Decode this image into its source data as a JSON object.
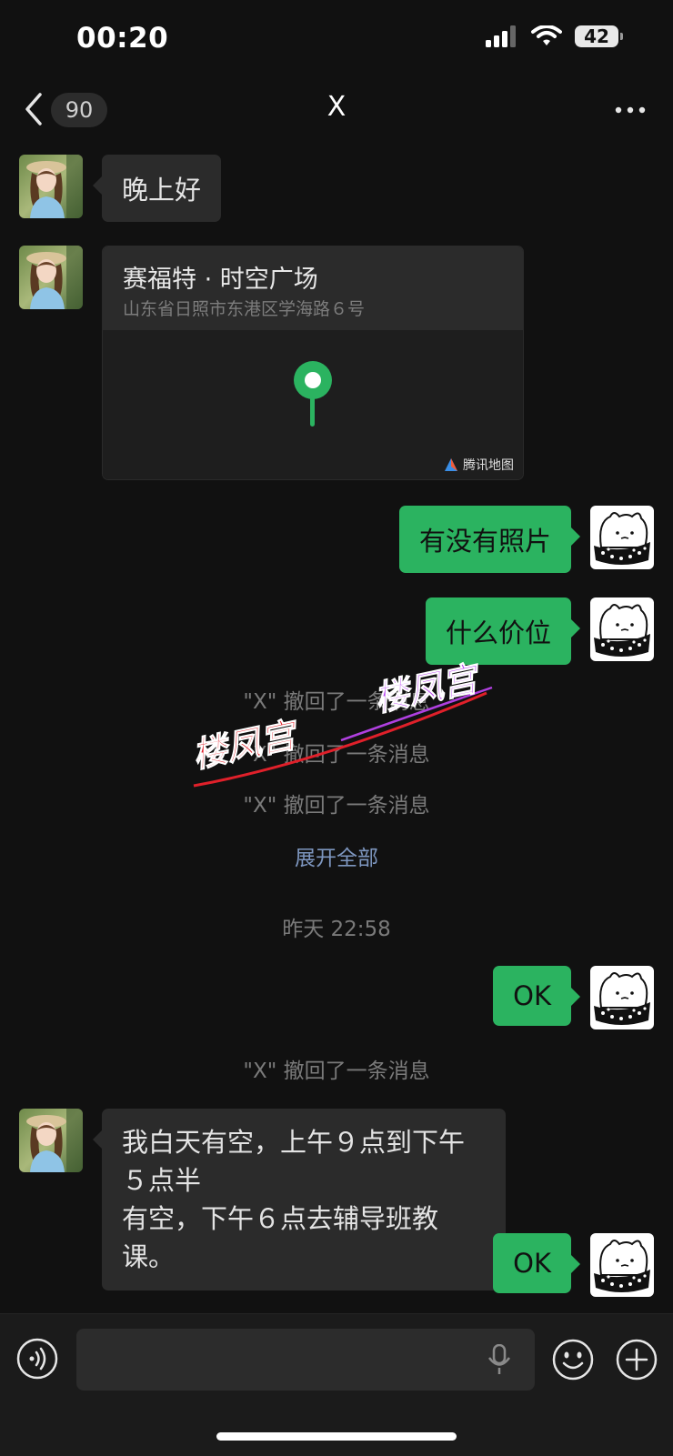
{
  "status_bar": {
    "time": "00:20",
    "battery": "42"
  },
  "nav": {
    "unread_count": "90",
    "title": "X"
  },
  "messages": {
    "m1": "晚上好",
    "location": {
      "name": "赛福特 · 时空广场",
      "address": "山东省日照市东港区学海路６号",
      "map_credit": "腾讯地图"
    },
    "m3": "有没有照片",
    "m4": "什么价位",
    "recall_1": "\"X\" 撤回了一条消息",
    "recall_2": "\"X\" 撤回了一条消息",
    "recall_3": "\"X\" 撤回了一条消息",
    "expand_all": "展开全部",
    "timestamp": "昨天 22:58",
    "m5": "OK",
    "recall_4": "\"X\" 撤回了一条消息",
    "m6_line1": "我白天有空，上午９点到下午５点半",
    "m6_line2": "有空，下午６点去辅导班教课。",
    "m7": "OK"
  },
  "watermark": {
    "text1": "楼凤宫",
    "text2": "楼凤宫"
  },
  "input": {
    "placeholder": ""
  },
  "colors": {
    "outgoing_bubble": "#2bb360",
    "incoming_bubble": "#2b2b2b",
    "background": "#111111",
    "link": "#7d96bf"
  }
}
